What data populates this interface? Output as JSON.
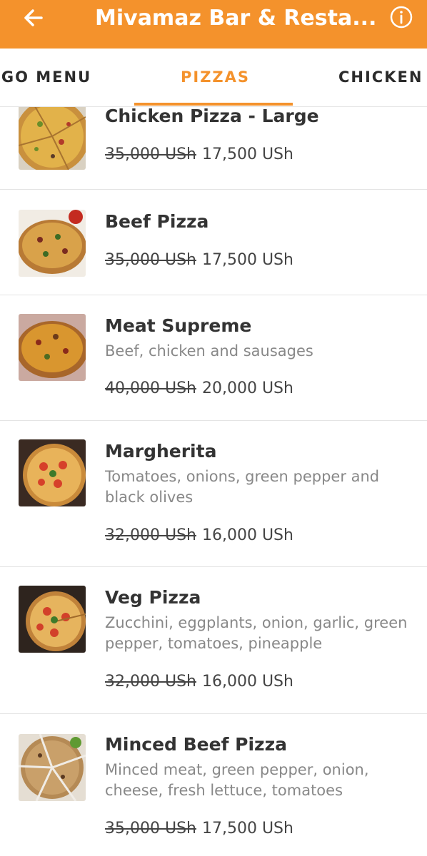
{
  "header": {
    "title": "Mivamaz Bar & Resta...",
    "background": "#f4922c",
    "back_icon": "arrow-left-icon",
    "info_icon": "info-circle-icon"
  },
  "tabs": [
    {
      "label": "OGO MENU"
    },
    {
      "label": "PIZZAS",
      "active": true
    },
    {
      "label": "CHICKEN"
    }
  ],
  "items": [
    {
      "name": "Chicken Pizza - Large",
      "desc": "",
      "old_price": "35,000 USh",
      "price": "17,500 USh"
    },
    {
      "name": "Beef Pizza",
      "desc": "",
      "old_price": "35,000 USh",
      "price": "17,500 USh"
    },
    {
      "name": "Meat Supreme",
      "desc": "Beef, chicken and sausages",
      "old_price": "40,000 USh",
      "price": "20,000 USh"
    },
    {
      "name": "Margherita",
      "desc": "Tomatoes, onions, green pepper and black olives",
      "old_price": "32,000 USh",
      "price": "16,000 USh"
    },
    {
      "name": "Veg Pizza",
      "desc": "Zucchini, eggplants, onion, garlic, green pepper, tomatoes, pineapple",
      "old_price": "32,000 USh",
      "price": "16,000 USh"
    },
    {
      "name": "Minced Beef Pizza",
      "desc": "Minced meat, green pepper, onion, cheese, fresh lettuce, tomatoes",
      "old_price": "35,000 USh",
      "price": "17,500 USh"
    }
  ]
}
